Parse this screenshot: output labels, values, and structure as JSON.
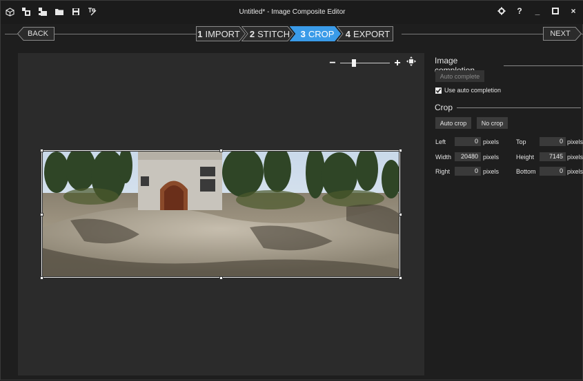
{
  "window": {
    "title": "Untitled* - Image Composite Editor",
    "toolbar_icons": [
      "app-cube-icon",
      "new-panorama-from-images-icon",
      "new-panorama-from-video-icon",
      "open-folder-icon",
      "save-icon",
      "publish-icon"
    ],
    "controls": {
      "settings_icon": "gear-icon",
      "help": "?",
      "minimize": "_",
      "maximize_icon": "maximize-icon",
      "close": "×"
    }
  },
  "workflow": {
    "back_label": "BACK",
    "next_label": "NEXT",
    "steps": [
      {
        "num": "1",
        "label": "IMPORT",
        "active": false
      },
      {
        "num": "2",
        "label": "STITCH",
        "active": false
      },
      {
        "num": "3",
        "label": "CROP",
        "active": true
      },
      {
        "num": "4",
        "label": "EXPORT",
        "active": false
      }
    ],
    "active_color": "#3a9be8"
  },
  "zoom": {
    "minus": "−",
    "plus": "+",
    "level": 0.25
  },
  "image_completion": {
    "heading": "Image completion",
    "auto_complete_label": "Auto complete",
    "auto_complete_enabled": false,
    "use_auto_label": "Use auto completion",
    "use_auto_checked": true
  },
  "crop": {
    "heading": "Crop",
    "auto_crop_label": "Auto crop",
    "no_crop_label": "No crop",
    "fields": {
      "left": {
        "label": "Left",
        "value": "0",
        "unit": "pixels"
      },
      "top": {
        "label": "Top",
        "value": "0",
        "unit": "pixels"
      },
      "width": {
        "label": "Width",
        "value": "20480",
        "unit": "pixels"
      },
      "height": {
        "label": "Height",
        "value": "7145",
        "unit": "pixels"
      },
      "right": {
        "label": "Right",
        "value": "0",
        "unit": "pixels"
      },
      "bottom": {
        "label": "Bottom",
        "value": "0",
        "unit": "pixels"
      }
    }
  }
}
